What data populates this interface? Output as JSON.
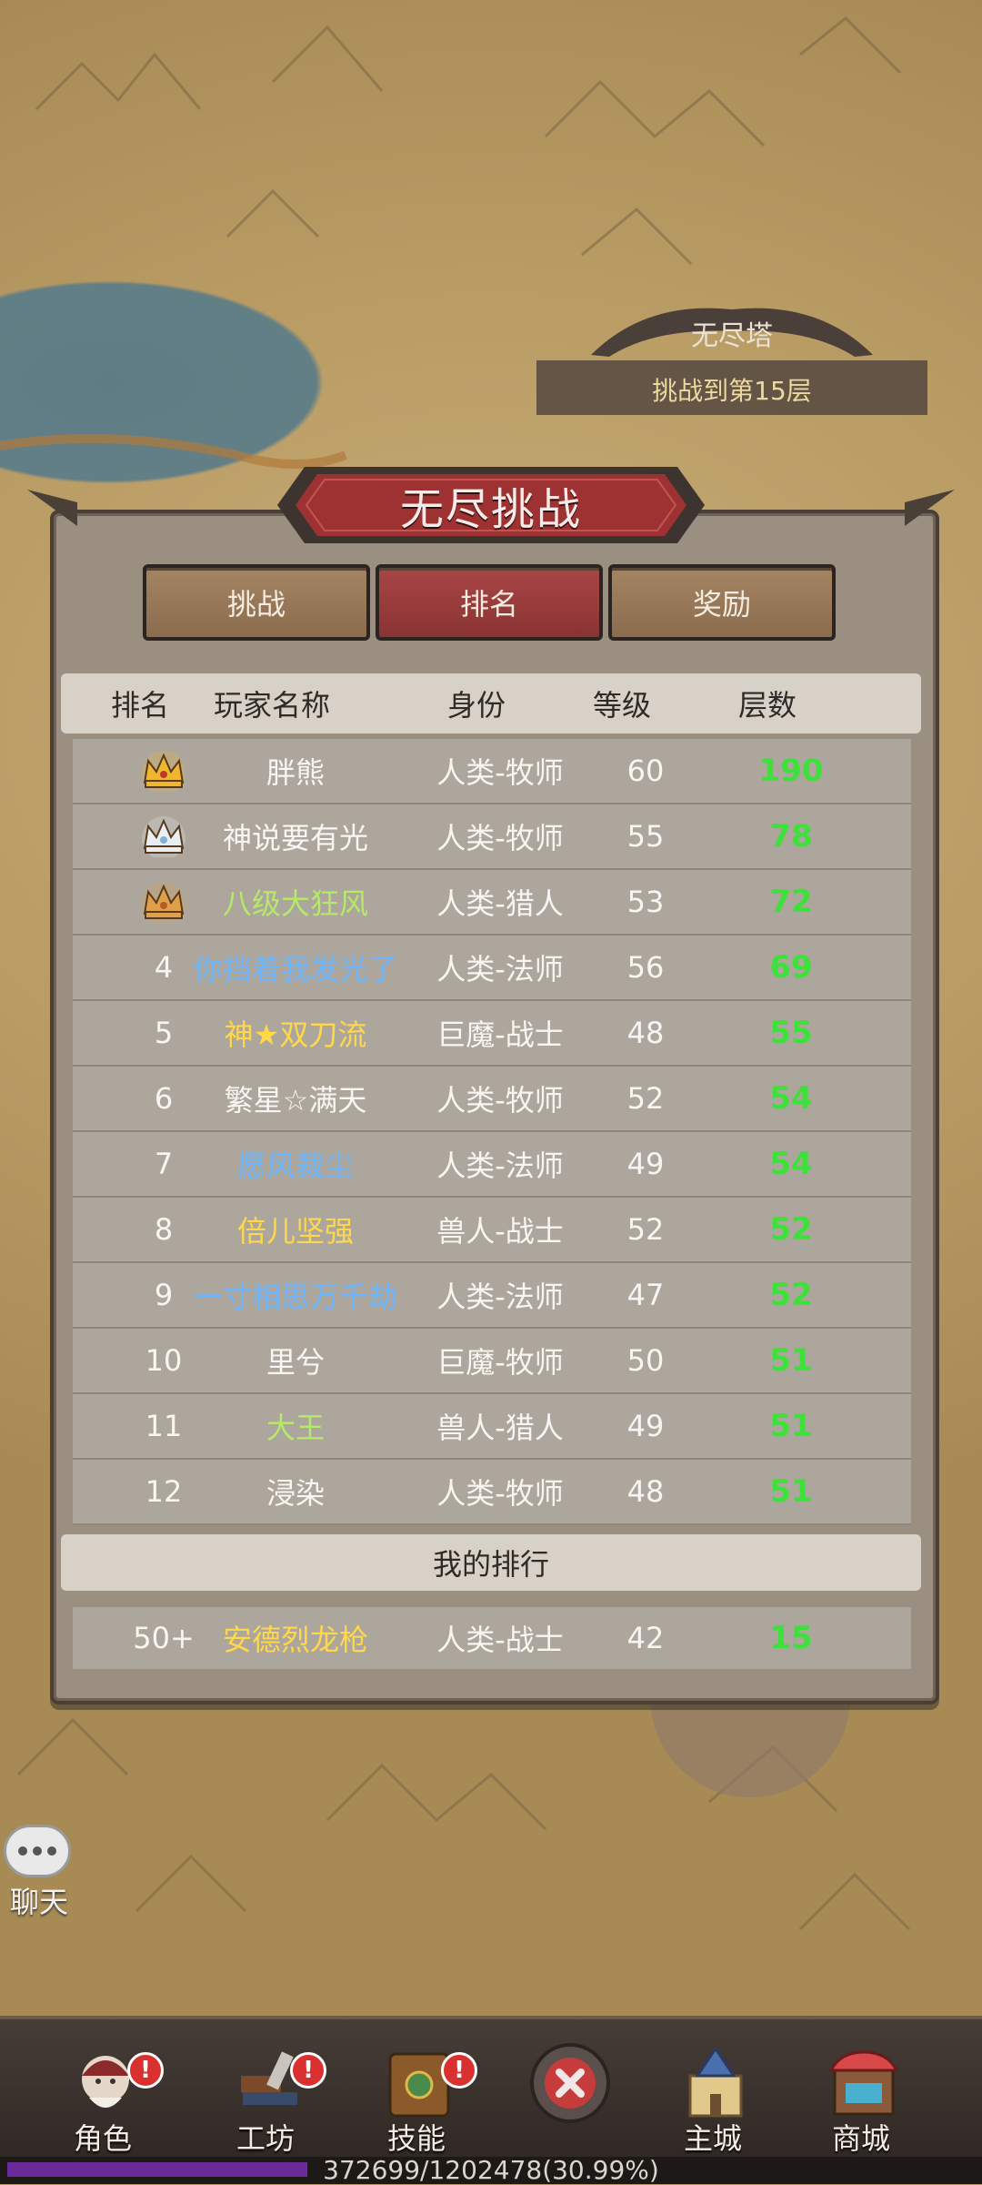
{
  "map": {
    "tower_title": "无尽塔",
    "tower_subtitle": "挑战到第15层"
  },
  "dialog": {
    "title": "无尽挑战",
    "tabs": [
      {
        "label": "挑战",
        "active": false
      },
      {
        "label": "排名",
        "active": true
      },
      {
        "label": "奖励",
        "active": false
      }
    ],
    "headers": [
      "排名",
      "玩家名称",
      "身份",
      "等级",
      "层数"
    ],
    "rows": [
      {
        "rank": "",
        "rank_icon": "gold-crown-icon",
        "name": "胖熊",
        "name_color": "#f8f6f2",
        "identity": "人类-牧师",
        "level": "60",
        "floors": "190"
      },
      {
        "rank": "",
        "rank_icon": "silver-crown-icon",
        "name": "神说要有光",
        "name_color": "#f8f6f2",
        "identity": "人类-牧师",
        "level": "55",
        "floors": "78"
      },
      {
        "rank": "",
        "rank_icon": "bronze-crown-icon",
        "name": "八级大狂风",
        "name_color": "#b6e86a",
        "identity": "人类-猎人",
        "level": "53",
        "floors": "72"
      },
      {
        "rank": "4",
        "rank_icon": "",
        "name": "你挡着我发光了",
        "name_color": "#6bb6ff",
        "identity": "人类-法师",
        "level": "56",
        "floors": "69"
      },
      {
        "rank": "5",
        "rank_icon": "",
        "name": "神★双刀流",
        "name_color": "#ffd84a",
        "identity": "巨魔-战士",
        "level": "48",
        "floors": "55"
      },
      {
        "rank": "6",
        "rank_icon": "",
        "name": "繁星☆满天",
        "name_color": "#f8f6f2",
        "identity": "人类-牧师",
        "level": "52",
        "floors": "54"
      },
      {
        "rank": "7",
        "rank_icon": "",
        "name": "愿风裁尘",
        "name_color": "#6bb6ff",
        "identity": "人类-法师",
        "level": "49",
        "floors": "54"
      },
      {
        "rank": "8",
        "rank_icon": "",
        "name": "倍儿坚强",
        "name_color": "#ffd84a",
        "identity": "兽人-战士",
        "level": "52",
        "floors": "52"
      },
      {
        "rank": "9",
        "rank_icon": "",
        "name": "一寸相思万千劫",
        "name_color": "#6bb6ff",
        "identity": "人类-法师",
        "level": "47",
        "floors": "52"
      },
      {
        "rank": "10",
        "rank_icon": "",
        "name": "里兮",
        "name_color": "#f8f6f2",
        "identity": "巨魔-牧师",
        "level": "50",
        "floors": "51"
      },
      {
        "rank": "11",
        "rank_icon": "",
        "name": "大王",
        "name_color": "#b6e86a",
        "identity": "兽人-猎人",
        "level": "49",
        "floors": "51"
      },
      {
        "rank": "12",
        "rank_icon": "",
        "name": "浸染",
        "name_color": "#f8f6f2",
        "identity": "人类-牧师",
        "level": "48",
        "floors": "51"
      }
    ],
    "my_rank_header": "我的排行",
    "my_row": {
      "rank": "50+",
      "name": "安德烈龙枪",
      "name_color": "#ffd84a",
      "identity": "人类-战士",
      "level": "42",
      "floors": "15"
    }
  },
  "chat": {
    "label": "聊天"
  },
  "nav": {
    "items": [
      {
        "label": "角色",
        "icon": "character-icon",
        "badge": "!"
      },
      {
        "label": "工坊",
        "icon": "workshop-icon",
        "badge": "!"
      },
      {
        "label": "技能",
        "icon": "skills-book-icon",
        "badge": "!"
      },
      {
        "label": "",
        "icon": "battle-close-icon",
        "badge": ""
      },
      {
        "label": "主城",
        "icon": "castle-icon",
        "badge": ""
      },
      {
        "label": "商城",
        "icon": "shop-icon",
        "badge": ""
      }
    ]
  },
  "xp": {
    "text": "372699/1202478(30.99%)",
    "fraction": 0.3099,
    "color": "#6b2b9b"
  }
}
